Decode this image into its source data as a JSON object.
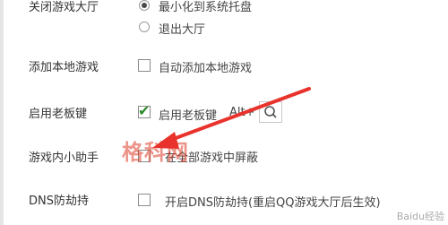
{
  "rows": {
    "close_lobby": {
      "label": "关闭游戏大厅",
      "opt1": "最小化到系统托盘",
      "opt2": "退出大厅"
    },
    "add_local": {
      "label": "添加本地游戏",
      "option": "自动添加本地游戏"
    },
    "boss_key": {
      "label": "启用老板键",
      "option": "启用老板键",
      "hotkey": "Alt+"
    },
    "in_game_helper": {
      "label": "游戏内小助手",
      "option": "在全部游戏中屏蔽"
    },
    "dns_hijack": {
      "label": "DNS防劫持",
      "option": "开启DNS防劫持(重启QQ游戏大厅后生效)"
    }
  },
  "overlays": {
    "watermark": "格科网",
    "corner_mark": "Baidu经验"
  },
  "colors": {
    "arrow": "#e8322b",
    "check": "#2a8a2a"
  },
  "icons": {
    "search": "search-icon",
    "checkmark": "checkmark-icon"
  }
}
